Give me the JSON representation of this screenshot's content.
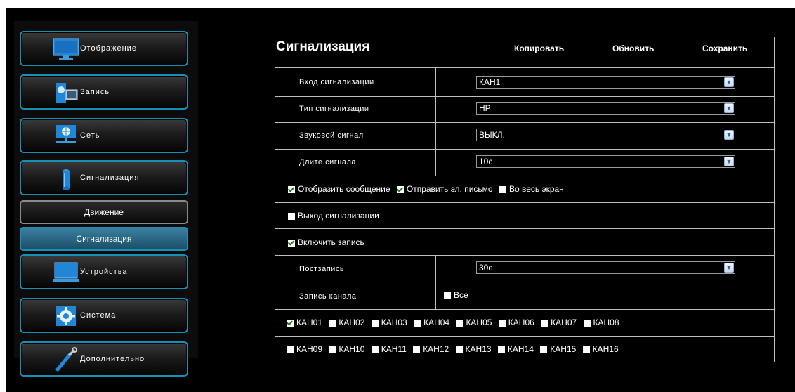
{
  "sidebar": {
    "items": [
      {
        "label": "Отображение",
        "icon": "monitor-icon"
      },
      {
        "label": "Запись",
        "icon": "record-icon"
      },
      {
        "label": "Сеть",
        "icon": "network-icon"
      },
      {
        "label": "Сигнализация",
        "icon": "alarm-icon"
      },
      {
        "label": "Устройства",
        "icon": "device-icon"
      },
      {
        "label": "Система",
        "icon": "system-gear-icon"
      },
      {
        "label": "Дополнительно",
        "icon": "tools-icon"
      }
    ],
    "subitems": [
      {
        "label": "Движение",
        "active": false
      },
      {
        "label": "Сигнализация",
        "active": true
      }
    ]
  },
  "header": {
    "title": "Сигнализация",
    "copy_label": "Копировать",
    "refresh_label": "Обновить",
    "save_label": "Сохранить"
  },
  "form": {
    "alarm_input": {
      "label": "Вход сигнализации",
      "value": "КАН1"
    },
    "alarm_type": {
      "label": "Тип сигнализации",
      "value": "НР"
    },
    "sound": {
      "label": "Звуковой сигнал",
      "value": "ВЫКЛ."
    },
    "duration": {
      "label": "Длите.сигнала",
      "value": "10с"
    },
    "show_message": {
      "label": "Отобразить сообщение",
      "checked": true
    },
    "send_email": {
      "label": "Отправить эл. письмо",
      "checked": true
    },
    "fullscreen": {
      "label": "Во весь экран",
      "checked": false
    },
    "alarm_output": {
      "label": "Выход сигнализации",
      "checked": false
    },
    "enable_record": {
      "label": "Включить запись",
      "checked": true
    },
    "post_record": {
      "label": "Постзапись",
      "value": "30с"
    },
    "channel_record": {
      "label": "Запись канала"
    },
    "all_channels": {
      "label": "Все",
      "checked": false
    },
    "channels": [
      {
        "label": "КАН01",
        "checked": true
      },
      {
        "label": "КАН02",
        "checked": false
      },
      {
        "label": "КАН03",
        "checked": false
      },
      {
        "label": "КАН04",
        "checked": false
      },
      {
        "label": "КАН05",
        "checked": false
      },
      {
        "label": "КАН06",
        "checked": false
      },
      {
        "label": "КАН07",
        "checked": false
      },
      {
        "label": "КАН08",
        "checked": false
      },
      {
        "label": "КАН09",
        "checked": false
      },
      {
        "label": "КАН10",
        "checked": false
      },
      {
        "label": "КАН11",
        "checked": false
      },
      {
        "label": "КАН12",
        "checked": false
      },
      {
        "label": "КАН13",
        "checked": false
      },
      {
        "label": "КАН14",
        "checked": false
      },
      {
        "label": "КАН15",
        "checked": false
      },
      {
        "label": "КАН16",
        "checked": false
      }
    ]
  },
  "colors": {
    "accent": "#1a8fb6",
    "background": "#000000",
    "active_sub": "#2a6a8a"
  }
}
